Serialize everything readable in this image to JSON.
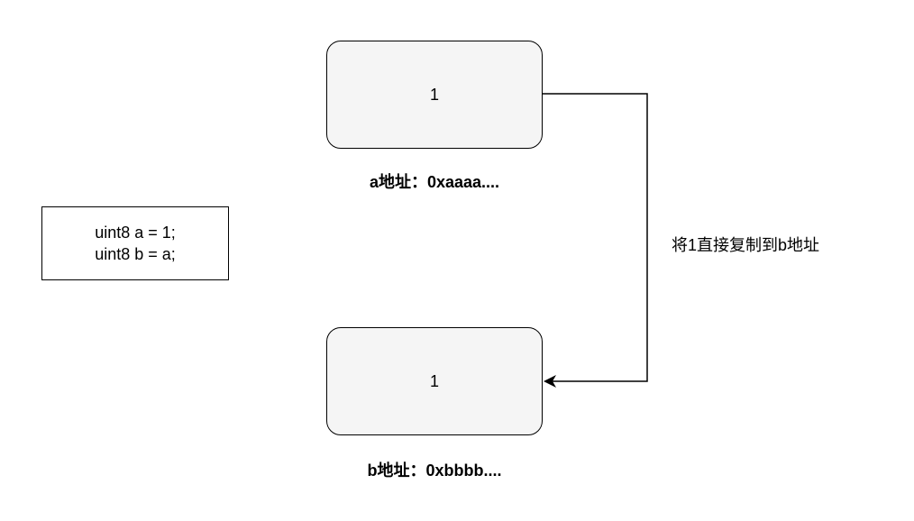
{
  "code": {
    "line1": "uint8 a = 1;",
    "line2": "uint8 b = a;"
  },
  "memory_a": {
    "value": "1",
    "address_label": "a地址：0xaaaa...."
  },
  "memory_b": {
    "value": "1",
    "address_label": "b地址：0xbbbb...."
  },
  "copy_annotation": "将1直接复制到b地址"
}
